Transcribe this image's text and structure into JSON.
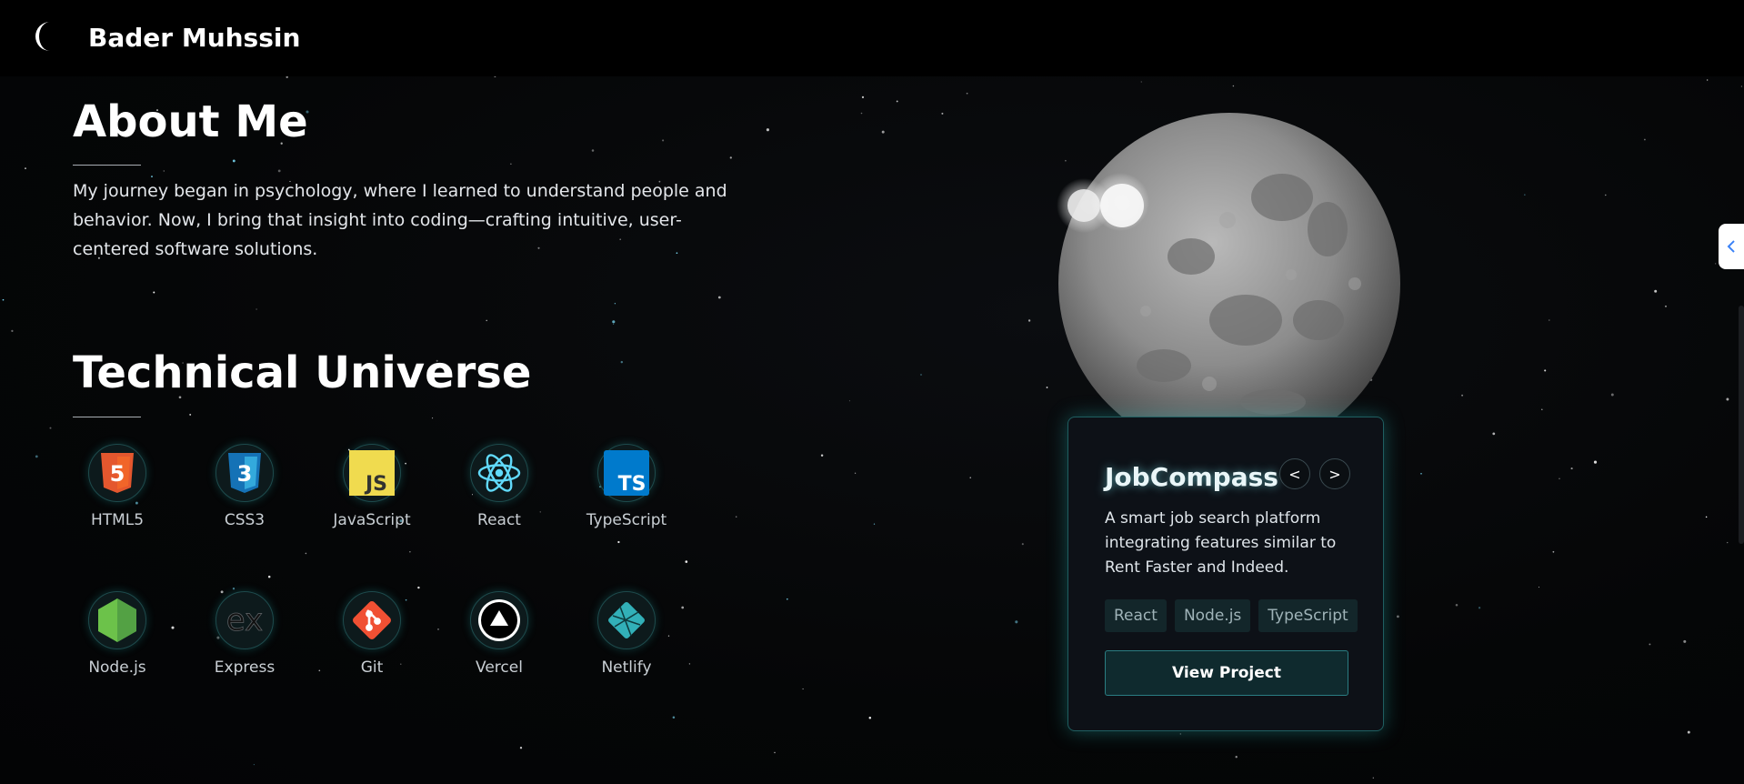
{
  "header": {
    "brand": "Bader Muhssin",
    "theme_toggle_icon": "crescent-moon-icon"
  },
  "about": {
    "title": "About Me",
    "text": "My journey began in psychology, where I learned to understand people and behavior. Now, I bring that insight into coding—crafting intuitive, user-centered software solutions."
  },
  "skills": {
    "title": "Technical Universe",
    "items": [
      {
        "label": "HTML5",
        "icon": "html5-icon"
      },
      {
        "label": "CSS3",
        "icon": "css3-icon"
      },
      {
        "label": "JavaScript",
        "icon": "javascript-icon"
      },
      {
        "label": "React",
        "icon": "react-icon"
      },
      {
        "label": "TypeScript",
        "icon": "typescript-icon"
      },
      {
        "label": "Node.js",
        "icon": "nodejs-icon"
      },
      {
        "label": "Express",
        "icon": "express-icon"
      },
      {
        "label": "Git",
        "icon": "git-icon"
      },
      {
        "label": "Vercel",
        "icon": "vercel-icon"
      },
      {
        "label": "Netlify",
        "icon": "netlify-icon"
      }
    ]
  },
  "project": {
    "title": "JobCompass",
    "prev_label": "<",
    "next_label": ">",
    "description": "A smart job search platform integrating features similar to Rent Faster and Indeed.",
    "tags": [
      "React",
      "Node.js",
      "TypeScript"
    ],
    "button_label": "View Project"
  },
  "colors": {
    "accent": "#2a9da3",
    "background": "#050607",
    "card": "#0d1117"
  }
}
